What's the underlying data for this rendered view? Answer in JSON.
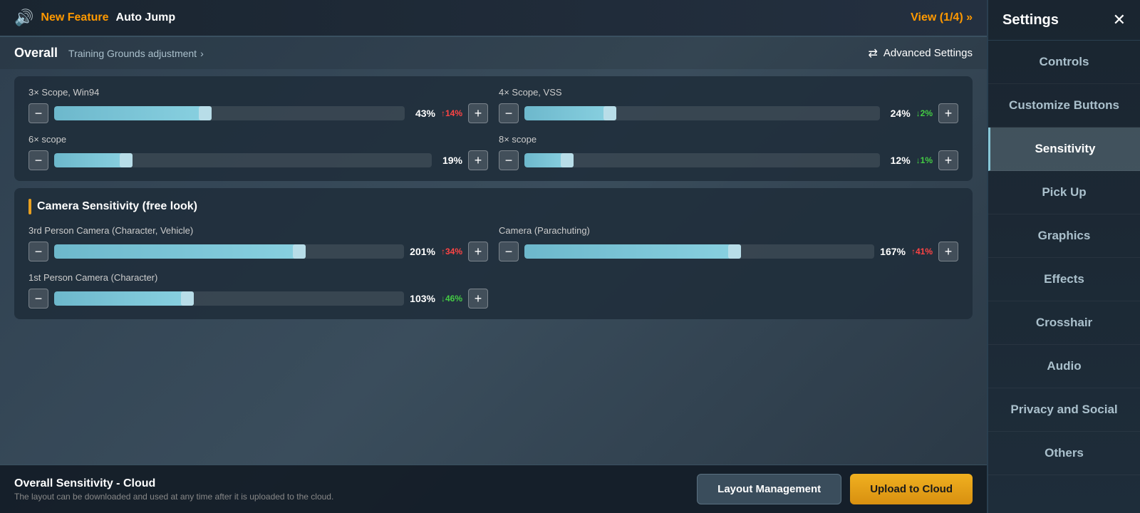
{
  "banner": {
    "speaker_icon": "🔊",
    "new_feature": "New Feature",
    "feature_name": "Auto Jump",
    "view_btn": "View (1/4) »"
  },
  "header": {
    "overall": "Overall",
    "training": "Training Grounds adjustment",
    "chevron": "›",
    "advanced_icon": "⇄",
    "advanced_settings": "Advanced Settings"
  },
  "scopes_section": {
    "scopes": [
      {
        "title": "3× Scope, Win94",
        "value": "43%",
        "change": "↑14%",
        "change_type": "up",
        "fill_pct": 43,
        "thumb_pct": 43
      },
      {
        "title": "4× Scope, VSS",
        "value": "24%",
        "change": "↓2%",
        "change_type": "down",
        "fill_pct": 24,
        "thumb_pct": 24
      },
      {
        "title": "6× scope",
        "value": "19%",
        "change": "",
        "change_type": "none",
        "fill_pct": 19,
        "thumb_pct": 19
      },
      {
        "title": "8× scope",
        "value": "12%",
        "change": "↓1%",
        "change_type": "down",
        "fill_pct": 12,
        "thumb_pct": 12
      }
    ]
  },
  "camera_section": {
    "title": "Camera Sensitivity (free look)",
    "cameras": [
      {
        "title": "3rd Person Camera (Character, Vehicle)",
        "value": "201%",
        "change": "↑34%",
        "change_type": "up",
        "fill_pct": 70,
        "thumb_pct": 70
      },
      {
        "title": "Camera (Parachuting)",
        "value": "167%",
        "change": "↑41%",
        "change_type": "up",
        "fill_pct": 60,
        "thumb_pct": 60
      },
      {
        "title": "1st Person Camera (Character)",
        "value": "103%",
        "change": "↓46%",
        "change_type": "down",
        "fill_pct": 38,
        "thumb_pct": 38
      }
    ]
  },
  "bottom": {
    "cloud_title": "Overall Sensitivity - Cloud",
    "cloud_desc": "The layout can be downloaded and used at any time after it is uploaded to the cloud.",
    "layout_btn": "Layout Management",
    "upload_btn": "Upload to Cloud"
  },
  "sidebar": {
    "title": "Settings",
    "close": "✕",
    "nav_items": [
      {
        "label": "Controls",
        "active": false
      },
      {
        "label": "Customize Buttons",
        "active": false
      },
      {
        "label": "Sensitivity",
        "active": true
      },
      {
        "label": "Pick Up",
        "active": false
      },
      {
        "label": "Graphics",
        "active": false
      },
      {
        "label": "Effects",
        "active": false
      },
      {
        "label": "Crosshair",
        "active": false
      },
      {
        "label": "Audio",
        "active": false
      },
      {
        "label": "Privacy and Social",
        "active": false
      },
      {
        "label": "Others",
        "active": false
      }
    ]
  }
}
